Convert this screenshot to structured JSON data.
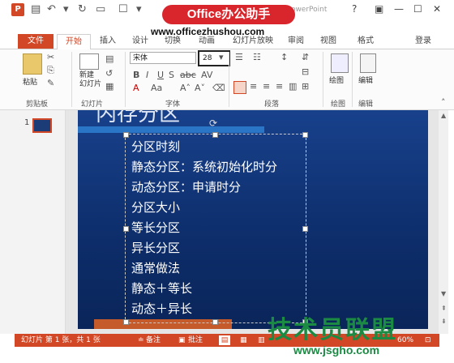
{
  "window": {
    "doc_title": "演示文稿1.pptx - PowerPoint",
    "help": "?",
    "controls": [
      "▣",
      "—",
      "☐",
      "✕"
    ]
  },
  "watermark": {
    "badge": "Office办公助手",
    "url": "www.officezhushou.com",
    "corner_cn": "技术员联盟",
    "corner_url": "www.jsgho.com"
  },
  "tabs": {
    "file": "文件",
    "items": [
      "开始",
      "插入",
      "设计",
      "切换",
      "动画",
      "幻灯片放映",
      "审阅",
      "视图",
      "格式"
    ],
    "login": "登录"
  },
  "ribbon": {
    "paste": "粘贴",
    "new_slide": "新建\n幻灯片",
    "font_name": "宋体",
    "font_size": "28",
    "groups": [
      "剪贴板",
      "幻灯片",
      "字体",
      "段落",
      "绘图",
      "编辑"
    ],
    "draw": "绘图",
    "edit": "编辑"
  },
  "thumbnail": {
    "number": "1"
  },
  "slide": {
    "title": "内存分区",
    "lines": [
      "分区时刻",
      "静态分区：系统初始化时分",
      "动态分区：申请时分",
      "分区大小",
      "等长分区",
      "异长分区",
      "通常做法",
      "静态＋等长",
      "动态＋异长"
    ]
  },
  "status": {
    "slide_info": "幻灯片 第 1 张，共 1 张",
    "notes": "备注",
    "comments": "批注",
    "zoom": "60%"
  }
}
